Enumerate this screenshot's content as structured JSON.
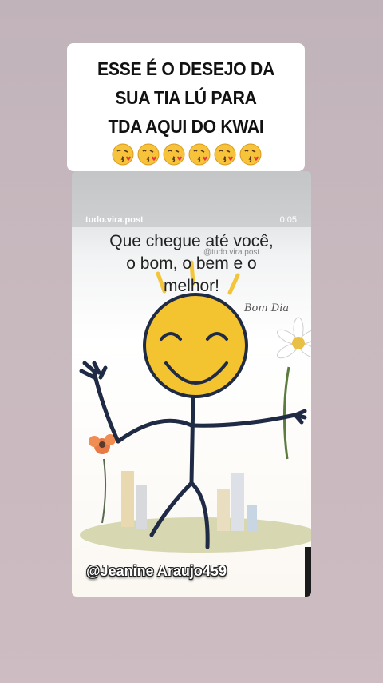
{
  "caption": {
    "text": "ESSE É  O DESEJO DA\nSUA TIA LÚ PARA\nTDA AQUI DO KWAI",
    "emoji_icon": "kissing-face-with-heart",
    "emoji_count": 6
  },
  "post": {
    "brand": "tudo.vira.post",
    "duration": "0:05",
    "phrase": "Que chegue até você,\no bom, o bem e o\nmelhor!",
    "watermark": "@tudo.vira.post",
    "greeting": "Bom Dia",
    "username": "@Jeanine Araujo459"
  },
  "colors": {
    "background": "#c4b6bc",
    "smiley": "#f4c430",
    "stick": "#1f2a44"
  }
}
